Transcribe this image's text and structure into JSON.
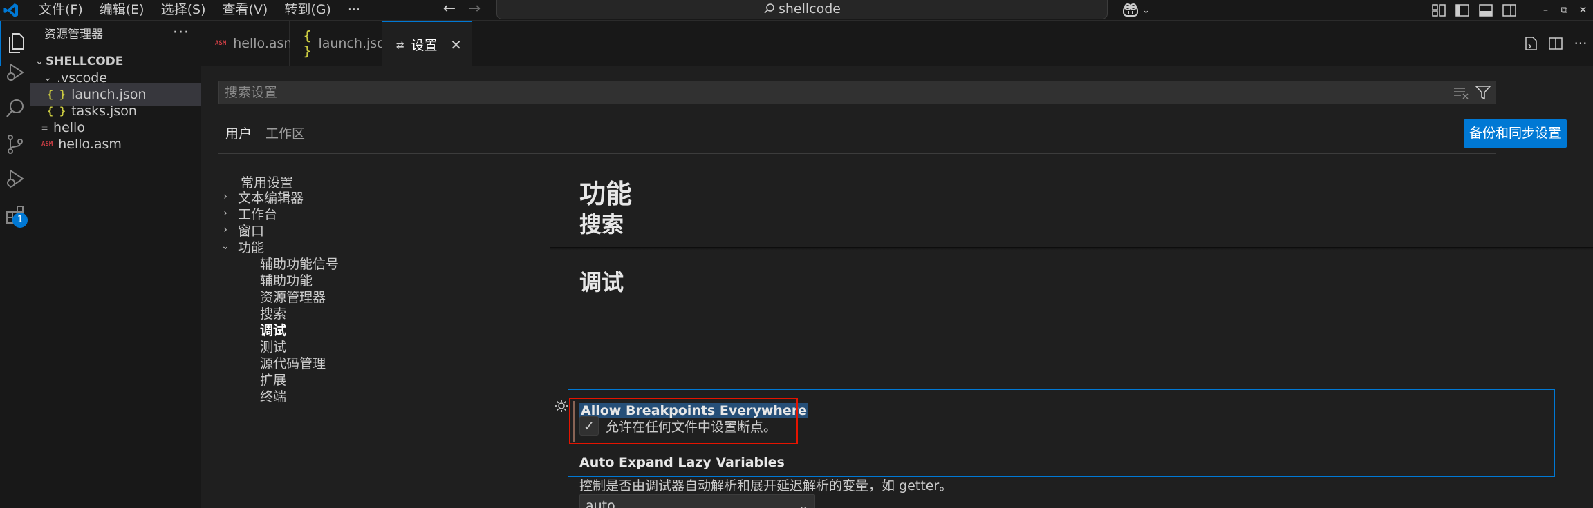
{
  "menu": [
    "文件(F)",
    "编辑(E)",
    "选择(S)",
    "查看(V)",
    "转到(G)",
    "···"
  ],
  "command_center": {
    "text": "shellcode"
  },
  "explorer": {
    "title": "资源管理器",
    "more": "···",
    "root": "SHELLCODE",
    "items": [
      {
        "label": ".vscode",
        "type": "folder"
      },
      {
        "label": "launch.json",
        "icon": "{ }",
        "selected": true
      },
      {
        "label": "tasks.json",
        "icon": "{ }"
      },
      {
        "label": "hello",
        "icon": "≡"
      },
      {
        "label": "hello.asm",
        "icon": "ASM"
      }
    ]
  },
  "activity_badge": "1",
  "tabs": [
    {
      "label": "hello.asm",
      "icon": "ASM"
    },
    {
      "label": "launch.json",
      "icon": "{ }"
    },
    {
      "label": "设置",
      "icon": "⇄",
      "active": true,
      "close": "✕"
    }
  ],
  "settings": {
    "search_placeholder": "搜索设置",
    "scopes": [
      "用户",
      "工作区"
    ],
    "sync_button": "备份和同步设置",
    "toc": [
      {
        "label": "常用设置",
        "level": 0
      },
      {
        "label": "文本编辑器",
        "level": 0,
        "chevron": "›"
      },
      {
        "label": "工作台",
        "level": 0,
        "chevron": "›"
      },
      {
        "label": "窗口",
        "level": 0,
        "chevron": "›"
      },
      {
        "label": "功能",
        "level": 0,
        "chevron": "⌄"
      },
      {
        "label": "辅助功能信号",
        "level": 1
      },
      {
        "label": "辅助功能",
        "level": 1
      },
      {
        "label": "资源管理器",
        "level": 1
      },
      {
        "label": "搜索",
        "level": 1
      },
      {
        "label": "调试",
        "level": 1,
        "active": true
      },
      {
        "label": "测试",
        "level": 1
      },
      {
        "label": "源代码管理",
        "level": 1
      },
      {
        "label": "扩展",
        "level": 1
      },
      {
        "label": "终端",
        "level": 1
      }
    ],
    "section_title": "功能",
    "subsection_search": "搜索",
    "subsection_debug": "调试",
    "setting1": {
      "title": "Allow Breakpoints Everywhere",
      "checkbox_label": "允许在任何文件中设置断点。",
      "checked": true
    },
    "setting2": {
      "title": "Auto Expand Lazy Variables",
      "description": "控制是否由调试器自动解析和展开延迟解析的变量，如 getter。",
      "value": "auto"
    }
  }
}
